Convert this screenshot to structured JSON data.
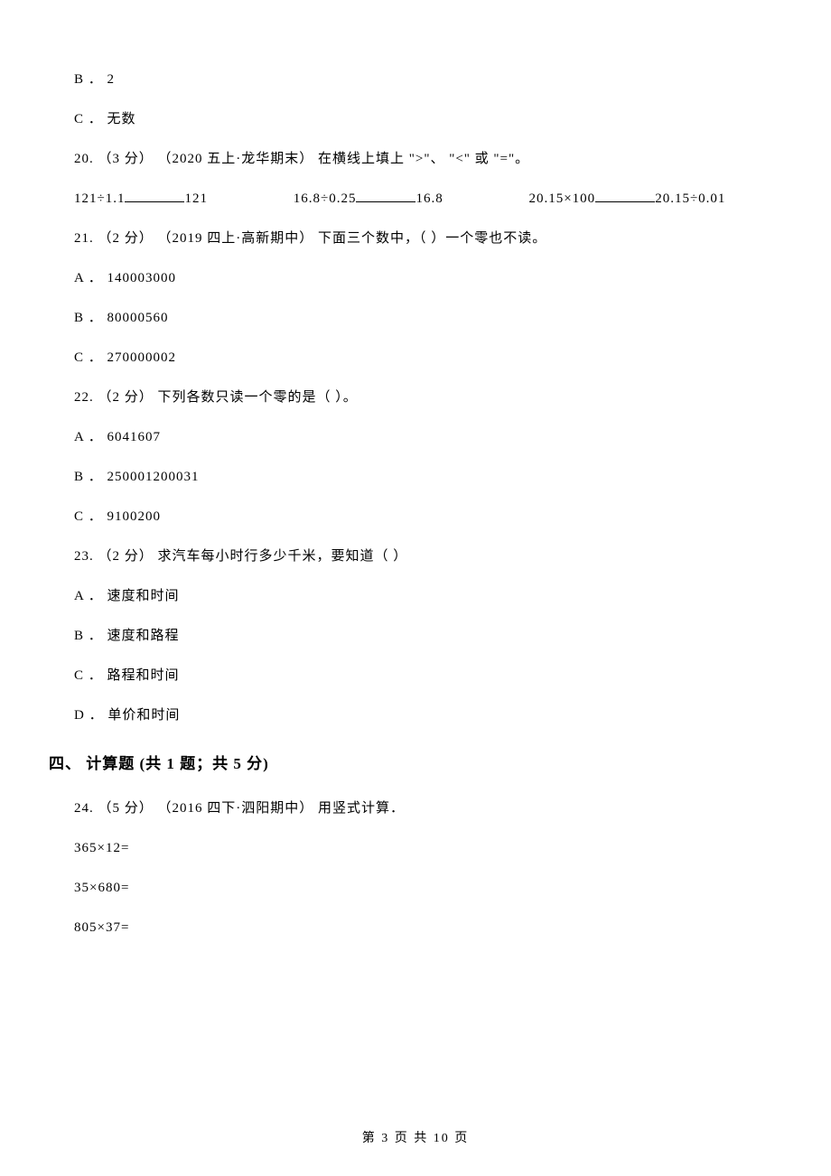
{
  "q_prev": {
    "opt_b": "B ． 2",
    "opt_c": "C ． 无数"
  },
  "q20": {
    "stem": "20.  （3 分） （2020 五上·龙华期末） 在横线上填上 \">\"、 \"<\" 或 \"=\"。",
    "parts": {
      "p1a": "121÷1.1",
      "p1b": "121",
      "p2a": "16.8÷0.25",
      "p2b": "16.8",
      "p3a": "20.15×100",
      "p3b": "20.15÷0.01"
    }
  },
  "q21": {
    "stem": "21.  （2 分） （2019 四上·高新期中） 下面三个数中，（    ）一个零也不读。",
    "opt_a": "A ． 140003000",
    "opt_b": "B ． 80000560",
    "opt_c": "C ． 270000002"
  },
  "q22": {
    "stem": "22.  （2 分）  下列各数只读一个零的是（    ）。",
    "opt_a": "A ． 6041607",
    "opt_b": "B ． 250001200031",
    "opt_c": "C ． 9100200"
  },
  "q23": {
    "stem": "23.  （2 分）  求汽车每小时行多少千米，要知道（    ）",
    "opt_a": "A ． 速度和时间",
    "opt_b": "B ． 速度和路程",
    "opt_c": "C ． 路程和时间",
    "opt_d": "D ． 单价和时间"
  },
  "section4": {
    "title": "四、  计算题  (共 1 题；共 5 分)"
  },
  "q24": {
    "stem": "24.  （5 分） （2016 四下·泗阳期中） 用竖式计算．",
    "calc1": "365×12=",
    "calc2": "35×680=",
    "calc3": "805×37="
  },
  "footer": "第 3 页 共 10 页"
}
